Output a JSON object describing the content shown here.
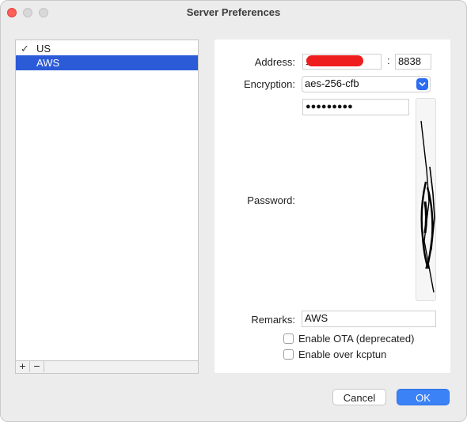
{
  "window": {
    "title": "Server Preferences"
  },
  "servers": {
    "items": [
      {
        "label": "US",
        "checked": true,
        "selected": false
      },
      {
        "label": "AWS",
        "checked": false,
        "selected": true
      }
    ],
    "add_label": "+",
    "remove_label": "−"
  },
  "form": {
    "address_label": "Address:",
    "address_value": "1",
    "colon": ":",
    "port_value": "8838",
    "encryption_label": "Encryption:",
    "encryption_value": "aes-256-cfb",
    "password_label": "Password:",
    "password_masked": "●●●●●●●●●",
    "remarks_label": "Remarks:",
    "remarks_value": "AWS",
    "ota_label": "Enable OTA (deprecated)",
    "ota_checked": false,
    "kcptun_label": "Enable over kcptun",
    "kcptun_checked": false
  },
  "buttons": {
    "cancel": "Cancel",
    "ok": "OK"
  },
  "colors": {
    "accent": "#3b82f6",
    "selection": "#2c5bd8",
    "redaction": "#ef1e1e"
  }
}
